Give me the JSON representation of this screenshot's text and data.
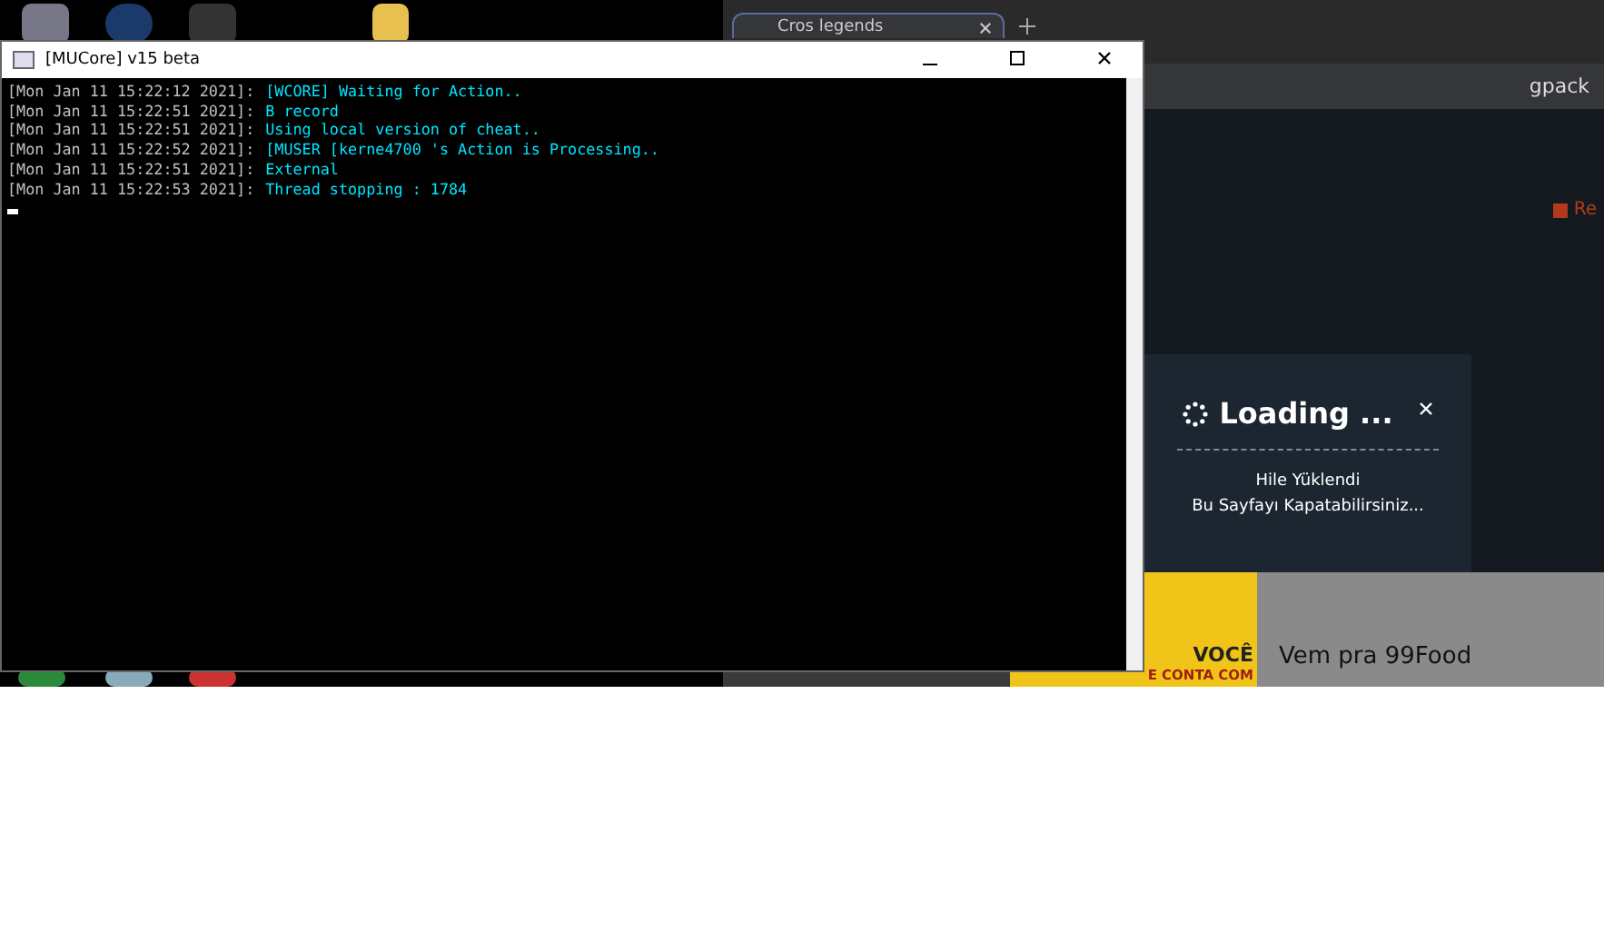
{
  "console_window": {
    "title": "[MUCore] v15 beta",
    "lines": [
      {
        "stamp": "[Mon Jan 11 15:22:12 2021]:",
        "message": "[WCORE] Waiting for Action.."
      },
      {
        "stamp": "[Mon Jan 11 15:22:51 2021]:",
        "message": "B record"
      },
      {
        "stamp": "[Mon Jan 11 15:22:51 2021]:",
        "message": "Using local version of cheat.."
      },
      {
        "stamp": "[Mon Jan 11 15:22:52 2021]:",
        "message": "[MUSER [kerne4700 's Action is Processing.."
      },
      {
        "stamp": "[Mon Jan 11 15:22:51 2021]:",
        "message": "External"
      },
      {
        "stamp": "[Mon Jan 11 15:22:53 2021]:",
        "message": "Thread stopping : 1784"
      }
    ]
  },
  "browser": {
    "tab": {
      "label": "Cros legends",
      "selected": true
    },
    "address": "gpack",
    "link": "Re",
    "loading": {
      "title": "Loading ...",
      "message": "Hile Yüklendi",
      "note": "Bu Sayfayı Kapatabilirsiniz..."
    },
    "ad": {
      "headline": "VOCÊ",
      "tagline": "E CONTA COM",
      "caption": "Vem pra 99Food"
    }
  }
}
